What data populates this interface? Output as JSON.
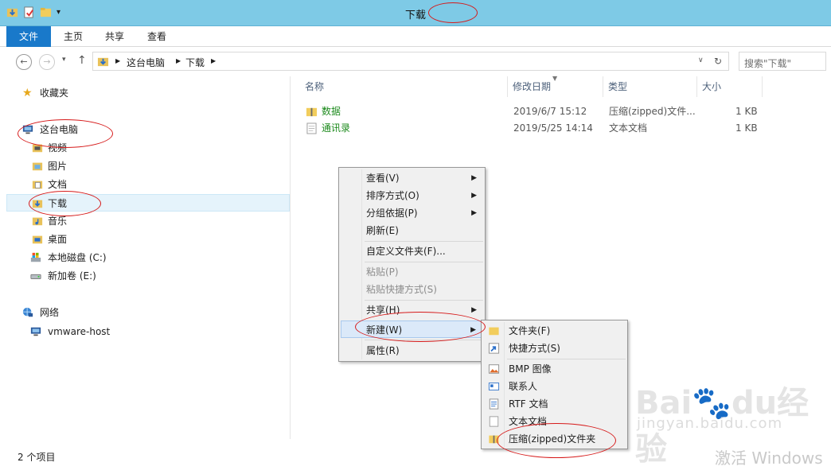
{
  "window": {
    "title": "下载",
    "ribbon_tabs": [
      "文件",
      "主页",
      "共享",
      "查看"
    ]
  },
  "address": {
    "path": [
      "这台电脑",
      "下载"
    ],
    "search_placeholder": "搜索\"下载\""
  },
  "sidebar": {
    "favorites": "收藏夹",
    "this_pc": "这台电脑",
    "pc_items": [
      "视频",
      "图片",
      "文档",
      "下载",
      "音乐",
      "桌面",
      "本地磁盘 (C:)",
      "新加卷 (E:)"
    ],
    "network": "网络",
    "network_items": [
      "vmware-host"
    ]
  },
  "file_list": {
    "columns": [
      "名称",
      "修改日期",
      "类型",
      "大小"
    ],
    "rows": [
      {
        "name": "数据",
        "date": "2019/6/7 15:12",
        "type": "压缩(zipped)文件...",
        "size": "1 KB"
      },
      {
        "name": "通讯录",
        "date": "2019/5/25 14:14",
        "type": "文本文档",
        "size": "1 KB"
      }
    ]
  },
  "status_bar": {
    "count": "2 个项目"
  },
  "context_menu": {
    "items": [
      "查看(V)",
      "排序方式(O)",
      "分组依据(P)",
      "刷新(E)",
      "自定义文件夹(F)...",
      "粘贴(P)",
      "粘贴快捷方式(S)",
      "共享(H)",
      "新建(W)",
      "属性(R)"
    ]
  },
  "new_submenu": {
    "items": [
      "文件夹(F)",
      "快捷方式(S)",
      "BMP 图像",
      "联系人",
      "RTF 文档",
      "文本文档",
      "压缩(zipped)文件夹"
    ]
  },
  "watermark": {
    "brand": "Baidu经验",
    "url": "jingyan.baidu.com",
    "activate": "激活 Windows"
  },
  "colors": {
    "ribbon_file": "#1979ca",
    "titlebar": "#7ecae6",
    "annotation": "#d61a1a"
  }
}
